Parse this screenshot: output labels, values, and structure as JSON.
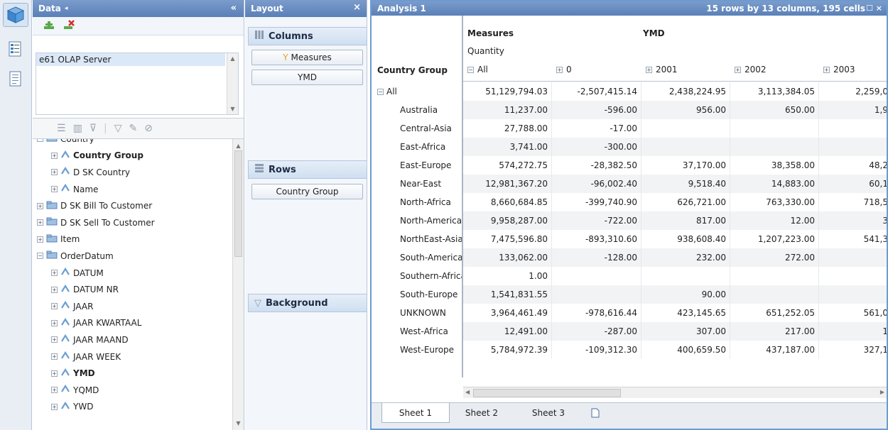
{
  "iconstrip": {
    "buttons": [
      {
        "icon": "cube-icon",
        "active": true
      },
      {
        "icon": "tree-list-icon",
        "active": false
      },
      {
        "icon": "report-icon",
        "active": false
      }
    ]
  },
  "data_panel": {
    "title": "Data",
    "collapse": "«",
    "servers": [
      "e61 OLAP Server"
    ],
    "tree": [
      {
        "label": "Country",
        "level": 1,
        "toggle": "-",
        "icon": "folder",
        "bold": false
      },
      {
        "label": "Country Group",
        "level": 2,
        "toggle": "+",
        "icon": "level",
        "bold": true
      },
      {
        "label": "D SK Country",
        "level": 2,
        "toggle": "+",
        "icon": "level",
        "bold": false
      },
      {
        "label": "Name",
        "level": 2,
        "toggle": "+",
        "icon": "level",
        "bold": false
      },
      {
        "label": "D SK Bill To Customer",
        "level": 1,
        "toggle": "+",
        "icon": "folder",
        "bold": false
      },
      {
        "label": "D SK Sell To Customer",
        "level": 1,
        "toggle": "+",
        "icon": "folder",
        "bold": false
      },
      {
        "label": "Item",
        "level": 1,
        "toggle": "+",
        "icon": "folder",
        "bold": false
      },
      {
        "label": "OrderDatum",
        "level": 1,
        "toggle": "-",
        "icon": "folder",
        "bold": false
      },
      {
        "label": "DATUM",
        "level": 2,
        "toggle": "+",
        "icon": "level",
        "bold": false
      },
      {
        "label": "DATUM NR",
        "level": 2,
        "toggle": "+",
        "icon": "level",
        "bold": false
      },
      {
        "label": "JAAR",
        "level": 2,
        "toggle": "+",
        "icon": "level",
        "bold": false
      },
      {
        "label": "JAAR KWARTAAL",
        "level": 2,
        "toggle": "+",
        "icon": "level",
        "bold": false
      },
      {
        "label": "JAAR MAAND",
        "level": 2,
        "toggle": "+",
        "icon": "level",
        "bold": false
      },
      {
        "label": "JAAR WEEK",
        "level": 2,
        "toggle": "+",
        "icon": "level",
        "bold": false
      },
      {
        "label": "YMD",
        "level": 2,
        "toggle": "+",
        "icon": "level",
        "bold": true
      },
      {
        "label": "YQMD",
        "level": 2,
        "toggle": "+",
        "icon": "level",
        "bold": false
      },
      {
        "label": "YWD",
        "level": 2,
        "toggle": "+",
        "icon": "level",
        "bold": false
      }
    ]
  },
  "layout_panel": {
    "title": "Layout",
    "columns_label": "Columns",
    "columns_items": [
      "Measures",
      "YMD"
    ],
    "rows_label": "Rows",
    "rows_items": [
      "Country Group"
    ],
    "background_label": "Background"
  },
  "analysis": {
    "title": "Analysis 1",
    "info": "15 rows by 13 columns, 195 cells",
    "measures_label": "Measures",
    "ymd_label": "YMD",
    "quantity_label": "Quantity",
    "row_header": "Country Group",
    "col_headers": [
      {
        "toggle": "-",
        "label": "All"
      },
      {
        "toggle": "+",
        "label": "0"
      },
      {
        "toggle": "+",
        "label": "2001"
      },
      {
        "toggle": "+",
        "label": "2002"
      },
      {
        "toggle": "+",
        "label": "2003"
      }
    ],
    "rows": [
      {
        "label": "All",
        "toggle": "-",
        "values": [
          "51,129,794.03",
          "-2,507,415.14",
          "2,438,224.95",
          "3,113,384.05",
          "2,259,0"
        ]
      },
      {
        "label": "Australia",
        "values": [
          "11,237.00",
          "-596.00",
          "956.00",
          "650.00",
          "1,9"
        ]
      },
      {
        "label": "Central-Asia",
        "values": [
          "27,788.00",
          "-17.00",
          "",
          "",
          ""
        ]
      },
      {
        "label": "East-Africa",
        "values": [
          "3,741.00",
          "-300.00",
          "",
          "",
          ""
        ]
      },
      {
        "label": "East-Europe",
        "values": [
          "574,272.75",
          "-28,382.50",
          "37,170.00",
          "38,358.00",
          "48,2"
        ]
      },
      {
        "label": "Near-East",
        "values": [
          "12,981,367.20",
          "-96,002.40",
          "9,518.40",
          "14,883.00",
          "60,1"
        ]
      },
      {
        "label": "North-Africa",
        "values": [
          "8,660,684.85",
          "-399,740.90",
          "626,721.00",
          "763,330.00",
          "718,5"
        ]
      },
      {
        "label": "North-America",
        "values": [
          "9,958,287.00",
          "-722.00",
          "817.00",
          "12.00",
          "3"
        ]
      },
      {
        "label": "NorthEast-Asia",
        "values": [
          "7,475,596.80",
          "-893,310.60",
          "938,608.40",
          "1,207,223.00",
          "541,3"
        ]
      },
      {
        "label": "South-America",
        "values": [
          "133,062.00",
          "-128.00",
          "232.00",
          "272.00",
          ""
        ]
      },
      {
        "label": "Southern-Africa",
        "values": [
          "1.00",
          "",
          "",
          "",
          ""
        ]
      },
      {
        "label": "South-Europe",
        "values": [
          "1,541,831.55",
          "",
          "90.00",
          "",
          ""
        ]
      },
      {
        "label": "UNKNOWN",
        "values": [
          "3,964,461.49",
          "-978,616.44",
          "423,145.65",
          "651,252.05",
          "561,0"
        ]
      },
      {
        "label": "West-Africa",
        "values": [
          "12,491.00",
          "-287.00",
          "307.00",
          "217.00",
          "1"
        ]
      },
      {
        "label": "West-Europe",
        "values": [
          "5,784,972.39",
          "-109,312.30",
          "400,659.50",
          "437,187.00",
          "327,1"
        ]
      }
    ],
    "tabs": [
      {
        "label": "Sheet 1",
        "active": true
      },
      {
        "label": "Sheet 2",
        "active": false
      },
      {
        "label": "Sheet 3",
        "active": false
      }
    ]
  }
}
